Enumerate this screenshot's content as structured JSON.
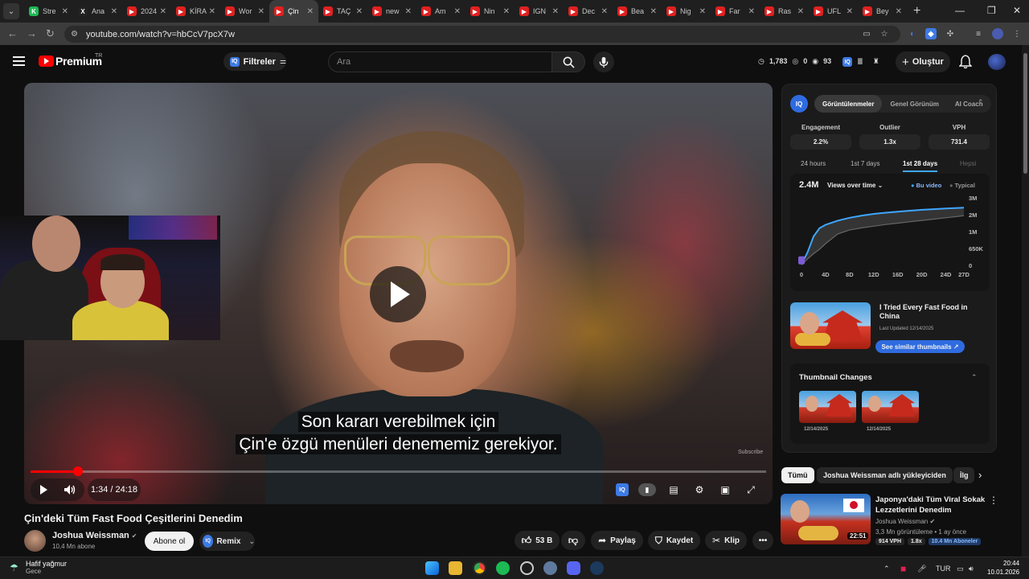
{
  "browser": {
    "tabs": [
      {
        "label": "Stre",
        "favicon_color": "#1db954",
        "favicon_glyph": "K"
      },
      {
        "label": "Ana",
        "favicon_color": "#222222",
        "favicon_glyph": "X"
      },
      {
        "label": "2024",
        "favicon_color": "#e02020",
        "favicon_glyph": "▶"
      },
      {
        "label": "KİRA",
        "favicon_color": "#e02020",
        "favicon_glyph": "▶"
      },
      {
        "label": "Wor",
        "favicon_color": "#e02020",
        "favicon_glyph": "▶"
      },
      {
        "label": "Çin",
        "favicon_color": "#e02020",
        "favicon_glyph": "▶"
      },
      {
        "label": "TAÇ",
        "favicon_color": "#e02020",
        "favicon_glyph": "▶"
      },
      {
        "label": "new",
        "favicon_color": "#e02020",
        "favicon_glyph": "▶"
      },
      {
        "label": "Am",
        "favicon_color": "#e02020",
        "favicon_glyph": "▶"
      },
      {
        "label": "Nin",
        "favicon_color": "#e02020",
        "favicon_glyph": "▶"
      },
      {
        "label": "IGN",
        "favicon_color": "#e02020",
        "favicon_glyph": "▶"
      },
      {
        "label": "Dec",
        "favicon_color": "#e02020",
        "favicon_glyph": "▶"
      },
      {
        "label": "Bea",
        "favicon_color": "#e02020",
        "favicon_glyph": "▶"
      },
      {
        "label": "Nig",
        "favicon_color": "#e02020",
        "favicon_glyph": "▶"
      },
      {
        "label": "Far",
        "favicon_color": "#e02020",
        "favicon_glyph": "▶"
      },
      {
        "label": "Ras",
        "favicon_color": "#e02020",
        "favicon_glyph": "▶"
      },
      {
        "label": "UFL",
        "favicon_color": "#e02020",
        "favicon_glyph": "▶"
      },
      {
        "label": "Bey",
        "favicon_color": "#e02020",
        "favicon_glyph": "▶"
      }
    ],
    "active_tab_index": 5,
    "url": "youtube.com/watch?v=hbCcV7pcX7w"
  },
  "yt_header": {
    "logo_text": "Premium",
    "logo_region": "TR",
    "filters_label": "Filtreler",
    "search_placeholder": "Ara",
    "stats": {
      "views": "1,783",
      "a": "0",
      "b": "93"
    },
    "create_label": "Oluştur"
  },
  "player": {
    "subtitle_line1": "Son kararı verebilmek için",
    "subtitle_line2": "Çin'e özgü menüleri denememiz gerekiyor.",
    "watermark": "Subscribe",
    "timecode": "1:34 / 24:18",
    "progress_fraction": 0.0645
  },
  "video": {
    "title": "Çin'deki Tüm Fast Food Çeşitlerini Denedim",
    "channel": "Joshua Weissman",
    "subscribers": "10,4 Mn abone",
    "subscribe_label": "Abone ol",
    "remix_label": "Remix",
    "likes": "53 B",
    "share_label": "Paylaş",
    "save_label": "Kaydet",
    "clip_label": "Klip"
  },
  "iq_panel": {
    "logo": "IQ",
    "tabs": [
      "Görüntülenmeler",
      "Genel Görünüm",
      "AI Coach"
    ],
    "active_tab_index": 0,
    "metrics": [
      {
        "label": "Engagement",
        "value": "2.2%"
      },
      {
        "label": "Outlier",
        "value": "1.3x"
      },
      {
        "label": "VPH",
        "value": "731.4"
      }
    ],
    "ranges": [
      "24 hours",
      "1st 7 days",
      "1st 28 days",
      "Hepsi"
    ],
    "active_range_index": 2,
    "chart_total": "2.4M",
    "chart_mode": "Views over time",
    "legend_this": "Bu video",
    "legend_typical": "Typical",
    "thumbnail": {
      "title": "I Tried Every Fast Food in China",
      "updated": "Last Updated 12/14/2025",
      "similar_label": "See similar thumbnails"
    },
    "changes": {
      "title": "Thumbnail Changes",
      "dates": [
        "12/14/2025",
        "12/14/2025"
      ]
    }
  },
  "chart_data": {
    "type": "line",
    "x": [
      0,
      1,
      2,
      3,
      4,
      6,
      8,
      10,
      12,
      14,
      16,
      18,
      20,
      22,
      24,
      26,
      27
    ],
    "xticks": [
      "0",
      "4D",
      "8D",
      "12D",
      "16D",
      "20D",
      "24D",
      "27D"
    ],
    "yticks": [
      "0",
      "650K",
      "1M",
      "2M",
      "3M"
    ],
    "series": [
      {
        "name": "Bu video",
        "color": "#3ea6ff",
        "values": [
          0.05,
          0.5,
          0.9,
          1.2,
          1.4,
          1.65,
          1.82,
          1.95,
          2.05,
          2.12,
          2.18,
          2.24,
          2.29,
          2.33,
          2.37,
          2.4,
          2.42
        ]
      },
      {
        "name": "Typical",
        "color": "#666666",
        "values": [
          0.02,
          0.25,
          0.45,
          0.62,
          0.75,
          0.95,
          1.1,
          1.22,
          1.32,
          1.42,
          1.5,
          1.58,
          1.66,
          1.74,
          1.82,
          1.9,
          1.95
        ]
      }
    ],
    "ylim": [
      0,
      3
    ]
  },
  "chips": [
    "Tümü",
    "Joshua Weissman adlı yükleyiciden",
    "İlg"
  ],
  "recommended": {
    "title": "Japonya'daki Tüm Viral Sokak Lezzetlerini Denedim",
    "channel": "Joshua Weissman",
    "meta": "3,3 Mn görüntüleme • 1 ay önce",
    "duration": "22:51",
    "badges": [
      "914 VPH",
      "1.8x",
      "10.4 Mn Aboneler"
    ]
  },
  "taskbar": {
    "weather_title": "Hafif yağmur",
    "weather_sub": "Gece",
    "lang": "TUR",
    "time": "20:44",
    "date": "10.01.2026"
  }
}
